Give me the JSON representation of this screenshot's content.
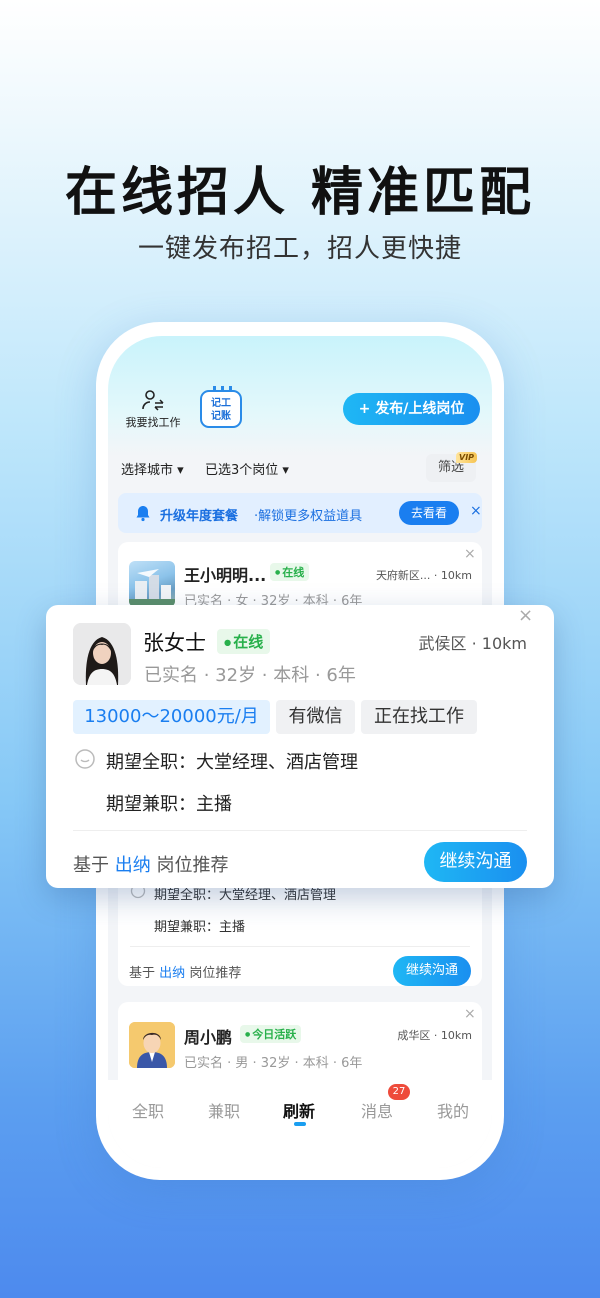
{
  "headline": "在线招人  精准匹配",
  "subline": "一键发布招工，招人更快捷",
  "topbar": {
    "find_work_label": "我要找工作",
    "ledger_line1": "记工",
    "ledger_line2": "记账",
    "publish_label": "+ 发布/上线岗位"
  },
  "filters": {
    "city": "选择城市 ▾",
    "positions": "已选3个岗位 ▾",
    "screen": "筛选",
    "vip": "VIP"
  },
  "banner": {
    "title": "升级年度套餐",
    "desc": "·解锁更多权益道具",
    "button": "去看看",
    "close": "×"
  },
  "card1": {
    "name": "王小明明...",
    "status": "在线",
    "location": "天府新区... · 10km",
    "meta": "已实名 · 女 · 32岁 · 本科 · 6年"
  },
  "popup": {
    "name": "张女士",
    "status": "在线",
    "location": "武侯区 · 10km",
    "meta": "已实名 · 32岁 · 本科 · 6年",
    "tags": [
      "13000～20000元/月",
      "有微信",
      "正在找工作"
    ],
    "full_time": "期望全职：大堂经理、酒店管理",
    "part_time": "期望兼职：主播",
    "recommend_prefix": "基于",
    "recommend_role": "出纳",
    "recommend_suffix": "岗位推荐",
    "button": "继续沟通",
    "close": "×"
  },
  "card2": {
    "full_time": "期望全职：大堂经理、酒店管理",
    "part_time": "期望兼职：主播",
    "recommend_prefix": "基于",
    "recommend_role": "出纳",
    "recommend_suffix": "岗位推荐",
    "button": "继续沟通"
  },
  "card3": {
    "name": "周小鹏",
    "status": "今日活跃",
    "location": "成华区 · 10km",
    "meta": "已实名 · 男 · 32岁 · 本科 · 6年",
    "close": "×"
  },
  "tabs": [
    "全职",
    "兼职",
    "刷新",
    "消息",
    "我的"
  ],
  "message_badge": "27",
  "colors": {
    "accent": "#1a7ef0",
    "online_green": "#28b04b",
    "badge_red": "#ee4b3b"
  }
}
